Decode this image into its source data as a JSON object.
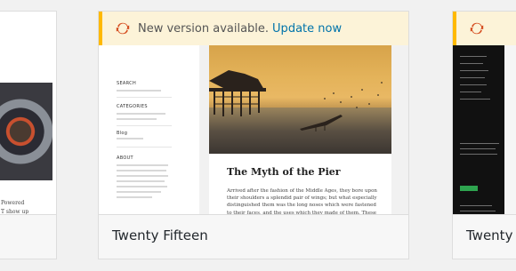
{
  "notice": {
    "text": "New version available.",
    "link": "Update now",
    "accent_color": "#ffb900",
    "icon": "update-icon"
  },
  "themes": [
    {
      "name": "",
      "caption_lines": [
        "Powered",
        "T show up"
      ]
    },
    {
      "name": "Twenty Fifteen",
      "preview": {
        "widgets": [
          {
            "label": "SEARCH"
          },
          {
            "label": "CATEGORIES"
          },
          {
            "label": "Blog"
          },
          {
            "label": "ABOUT"
          }
        ],
        "post_title": "The Myth of the Pier",
        "post_excerpt": "Arrived after the fashion of the Middle Ages, they bore upon their shoulders a splendid pair of wings; but what especially distinguished them was the long noses which were fastened to their faces, and the uses which they made of them. These noses were made of bamboo, and were five, six, and even ten feet long, some straight, others curved, some ribboned, and some having imitation warts upon them."
      }
    },
    {
      "name": "Twenty F"
    }
  ]
}
